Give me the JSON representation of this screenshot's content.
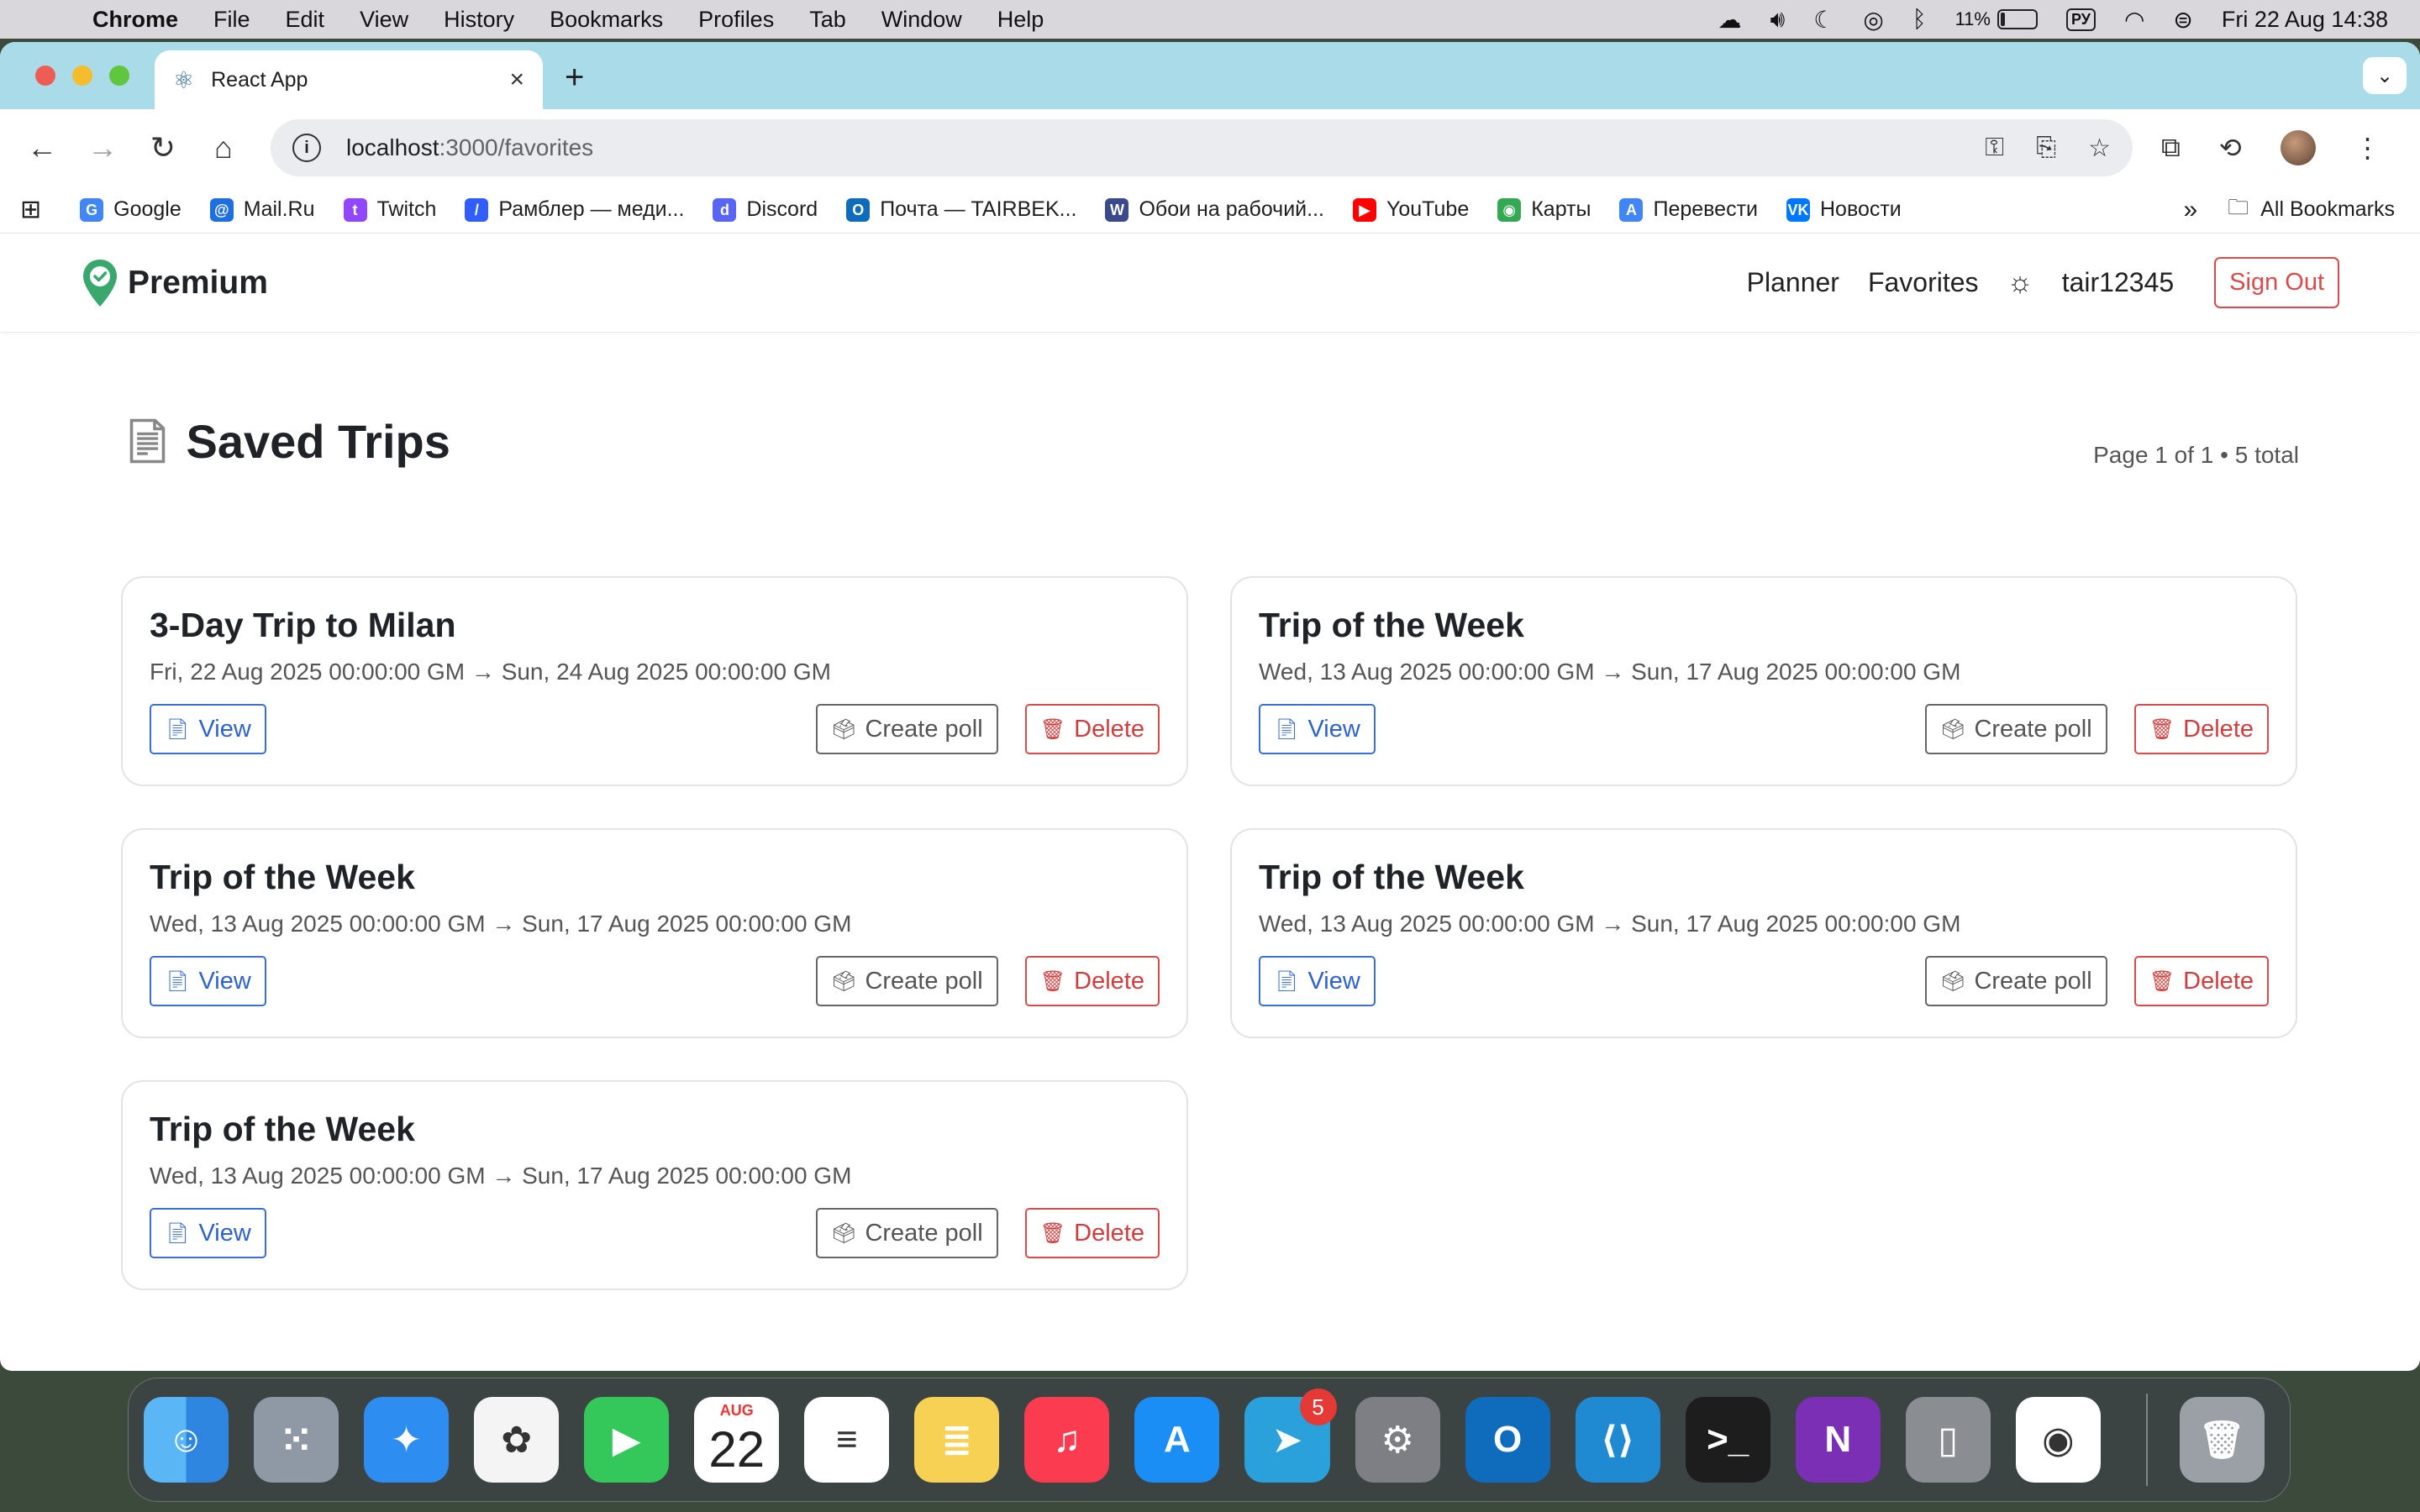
{
  "menubar": {
    "app": "Chrome",
    "items": [
      "File",
      "Edit",
      "View",
      "History",
      "Bookmarks",
      "Profiles",
      "Tab",
      "Window",
      "Help"
    ],
    "battery_percent": "11%",
    "input_source": "РУ",
    "datetime": "Fri 22 Aug  14:38"
  },
  "browser": {
    "tab_title": "React App",
    "url_host": "localhost",
    "url_path": ":3000/favorites",
    "bookmarks": [
      {
        "label": "Google",
        "icon": "google-icon",
        "color": "#4285f4",
        "glyph": "G"
      },
      {
        "label": "Mail.Ru",
        "icon": "mailru-icon",
        "color": "#1f6fe0",
        "glyph": "@"
      },
      {
        "label": "Twitch",
        "icon": "twitch-icon",
        "color": "#9146ff",
        "glyph": "t"
      },
      {
        "label": "Рамблер — меди...",
        "icon": "rambler-icon",
        "color": "#315efb",
        "glyph": "/"
      },
      {
        "label": "Discord",
        "icon": "discord-icon",
        "color": "#5865f2",
        "glyph": "d"
      },
      {
        "label": "Почта — TAIRBEK...",
        "icon": "outlook-icon",
        "color": "#0f6cbd",
        "glyph": "O"
      },
      {
        "label": "Обои на рабочий...",
        "icon": "wallpaper-icon",
        "color": "#3a4a8a",
        "glyph": "W"
      },
      {
        "label": "YouTube",
        "icon": "youtube-icon",
        "color": "#ff0000",
        "glyph": "▶"
      },
      {
        "label": "Карты",
        "icon": "maps-icon",
        "color": "#34a853",
        "glyph": "◉"
      },
      {
        "label": "Перевести",
        "icon": "translate-icon",
        "color": "#4285f4",
        "glyph": "A"
      },
      {
        "label": "Новости",
        "icon": "vk-icon",
        "color": "#0077ff",
        "glyph": "VK"
      }
    ],
    "all_bookmarks": "All Bookmarks"
  },
  "app": {
    "brand": "Premium",
    "nav": {
      "planner": "Planner",
      "favorites": "Favorites",
      "username": "tair12345",
      "signout": "Sign Out"
    },
    "page_title": "Saved Trips",
    "pager": "Page 1 of 1 • 5 total",
    "buttons": {
      "view": "View",
      "poll": "Create poll",
      "delete": "Delete"
    },
    "trips": [
      {
        "title": "3-Day Trip to Milan",
        "dates": "Fri, 22 Aug 2025 00:00:00 GM → Sun, 24 Aug 2025 00:00:00 GM"
      },
      {
        "title": "Trip of the Week",
        "dates": "Wed, 13 Aug 2025 00:00:00 GM → Sun, 17 Aug 2025 00:00:00 GM"
      },
      {
        "title": "Trip of the Week",
        "dates": "Wed, 13 Aug 2025 00:00:00 GM → Sun, 17 Aug 2025 00:00:00 GM"
      },
      {
        "title": "Trip of the Week",
        "dates": "Wed, 13 Aug 2025 00:00:00 GM → Sun, 17 Aug 2025 00:00:00 GM"
      },
      {
        "title": "Trip of the Week",
        "dates": "Wed, 13 Aug 2025 00:00:00 GM → Sun, 17 Aug 2025 00:00:00 GM"
      }
    ]
  },
  "dock": {
    "apps": [
      {
        "name": "finder",
        "bg": "linear-gradient(90deg,#5ab6f5 50%,#2e86e0 50%)",
        "glyph": "☺"
      },
      {
        "name": "launchpad",
        "bg": "#8f99a6",
        "glyph": "⁙"
      },
      {
        "name": "safari",
        "bg": "#2d8df0",
        "glyph": "✦"
      },
      {
        "name": "photos",
        "bg": "#f4f4f4",
        "glyph": "✿"
      },
      {
        "name": "facetime",
        "bg": "#34c759",
        "glyph": "▶"
      },
      {
        "name": "calendar",
        "bg": "#ffffff",
        "glyph": ""
      },
      {
        "name": "reminders",
        "bg": "#ffffff",
        "glyph": "≡"
      },
      {
        "name": "notes",
        "bg": "#f7d154",
        "glyph": "≣"
      },
      {
        "name": "music",
        "bg": "#fb3b4f",
        "glyph": "♫"
      },
      {
        "name": "app-store",
        "bg": "#1b8ef5",
        "glyph": "A"
      },
      {
        "name": "telegram",
        "bg": "#2aa1da",
        "glyph": "➤"
      },
      {
        "name": "system-settings",
        "bg": "#7d7f85",
        "glyph": "⚙"
      },
      {
        "name": "outlook",
        "bg": "#0f6cbd",
        "glyph": "O"
      },
      {
        "name": "vscode",
        "bg": "#1f8ad2",
        "glyph": "⟨⟩"
      },
      {
        "name": "terminal",
        "bg": "#1d1d1d",
        "glyph": ">_"
      },
      {
        "name": "onenote",
        "bg": "#7b2fb5",
        "glyph": "N"
      },
      {
        "name": "iphone-mirroring",
        "bg": "#8a8d92",
        "glyph": "▯"
      },
      {
        "name": "chrome",
        "bg": "#ffffff",
        "glyph": "◉"
      }
    ],
    "calendar_month": "AUG",
    "calendar_day": "22",
    "telegram_badge": "5"
  },
  "colors": {
    "accent_blue": "#2e62cf",
    "danger_red": "#d23c3c",
    "brand_green": "#3aa76d",
    "tabstrip": "#a9dbe8"
  }
}
